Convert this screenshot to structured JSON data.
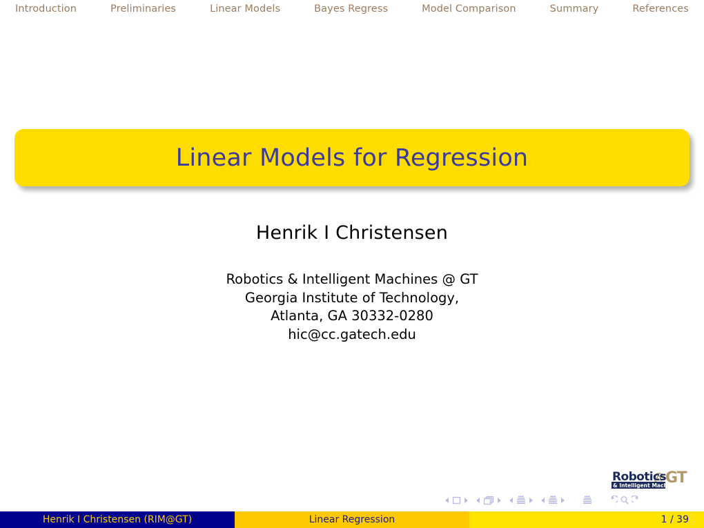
{
  "colors": {
    "nav_text": "#9d7b5e",
    "title_box_bg": "#ffdd00",
    "title_text": "#3b3b9e",
    "footer_left_bg": "#00008f",
    "footer_left_text": "#ffcc00",
    "footer_mid_bg": "#ffc900",
    "footer_right_bg": "#ffe400",
    "footer_text": "#1a1a8c",
    "logo_navy": "#1b2a5e",
    "logo_tan": "#b39a6d"
  },
  "navbar": {
    "items": [
      {
        "label": "Introduction"
      },
      {
        "label": "Preliminaries"
      },
      {
        "label": "Linear Models"
      },
      {
        "label": "Bayes Regress"
      },
      {
        "label": "Model Comparison"
      },
      {
        "label": "Summary"
      },
      {
        "label": "References"
      }
    ]
  },
  "title": {
    "text": "Linear Models for Regression"
  },
  "author": {
    "name": "Henrik I Christensen"
  },
  "institute": {
    "lines": [
      "Robotics & Intelligent Machines @ GT",
      "Georgia Institute of Technology,",
      "Atlanta, GA 30332-0280",
      "hic@cc.gatech.edu"
    ]
  },
  "logo": {
    "primary_text": "Robotics",
    "at_symbol": "@",
    "gt_text": "GT",
    "tagline": "& Intelligent Machines"
  },
  "navsymbols": {
    "groups": [
      {
        "icon": "slide-icon",
        "prev": "previous-slide-icon",
        "next": "next-slide-icon"
      },
      {
        "icon": "frame-icon",
        "prev": "previous-frame-icon",
        "next": "next-frame-icon"
      },
      {
        "icon": "subsection-icon",
        "prev": "previous-subsection-icon",
        "next": "next-subsection-icon"
      },
      {
        "icon": "section-icon",
        "prev": "previous-section-icon",
        "next": "next-section-icon"
      }
    ],
    "presentation": "presentation-icon",
    "back": "go-back-icon",
    "search": "search-icon",
    "forward": "go-forward-icon"
  },
  "footer": {
    "author": "Henrik I Christensen  (RIM@GT)",
    "title": "Linear Regression",
    "page": "1 / 39"
  }
}
